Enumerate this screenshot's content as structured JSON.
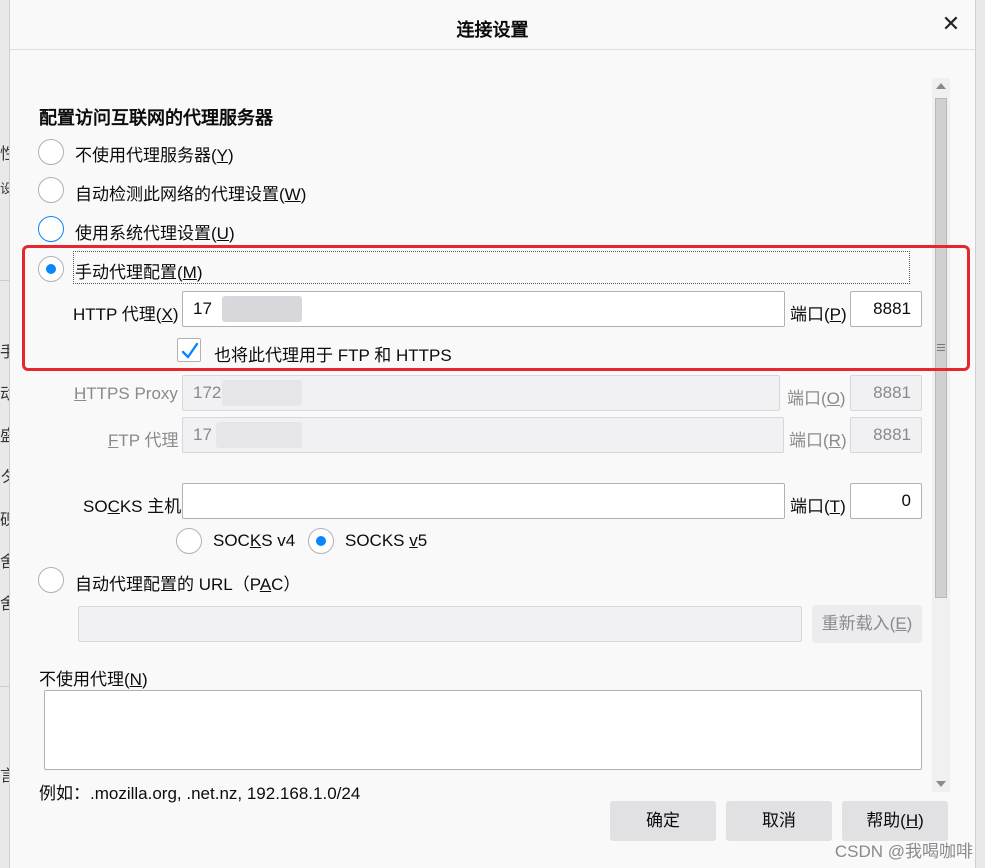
{
  "dialog": {
    "title": "连接设置",
    "close_glyph": "✕"
  },
  "section_heading": "配置访问互联网的代理服务器",
  "proxy_modes": [
    {
      "label_pre": "不使用代理服务器(",
      "key": "Y",
      "label_post": ")",
      "checked": false
    },
    {
      "label_pre": "自动检测此网络的代理设置(",
      "key": "W",
      "label_post": ")",
      "checked": false
    },
    {
      "label_pre": "使用系统代理设置(",
      "key": "U",
      "label_post": ")",
      "checked": false
    },
    {
      "label_pre": "手动代理配置(",
      "key": "M",
      "label_post": ")",
      "checked": true
    }
  ],
  "http": {
    "label_pre": "HTTP 代理(",
    "key": "X",
    "label_post": ")",
    "value": "17",
    "port_label_pre": "端口(",
    "port_key": "P",
    "port_label_post": ")",
    "port": "8881"
  },
  "also_use": {
    "label": "也将此代理用于 FTP 和 HTTPS",
    "checked": true
  },
  "https": {
    "label": "HTTPS Proxy",
    "key": "H",
    "value": "172",
    "port_label_pre": "端口(",
    "port_key": "O",
    "port_label_post": ")",
    "port": "8881"
  },
  "ftp": {
    "label_post": "TP 代理",
    "key": "F",
    "value": "17",
    "port_label_pre": "端口(",
    "port_key": "R",
    "port_label_post": ")",
    "port": "8881"
  },
  "socks": {
    "label_pre": "SO",
    "key": "C",
    "label_post": "KS 主机",
    "value": "",
    "port_label_pre": "端口(",
    "port_key": "T",
    "port_label_post": ")",
    "port": "0",
    "v4_pre": "SOC",
    "v4_key": "K",
    "v4_post": "S v4",
    "v5_pre": "SOCKS ",
    "v5_key": "v",
    "v5_post": "5",
    "selected": "v5"
  },
  "pac": {
    "label_pre": "自动代理配置的 URL（P",
    "key": "A",
    "label_post": "C）",
    "url": "",
    "reload_pre": "重新载入(",
    "reload_key": "E",
    "reload_post": ")"
  },
  "no_proxy": {
    "label_pre": "不使用代理(",
    "key": "N",
    "label_post": ")",
    "value": "",
    "example": "例如：.mozilla.org, .net.nz, 192.168.1.0/24"
  },
  "buttons": {
    "ok": "确定",
    "cancel": "取消",
    "help_pre": "帮助(",
    "help_key": "H",
    "help_post": ")"
  },
  "watermark": "CSDN @我喝咖啡",
  "colors": {
    "accent": "#0a84ff",
    "highlight": "#e8262f"
  }
}
